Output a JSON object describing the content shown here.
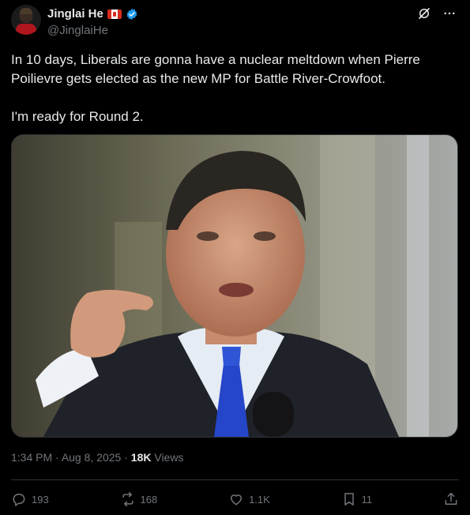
{
  "author": {
    "display_name": "Jinglai He",
    "handle": "@JinglaiHe",
    "flag_icon": "canada-flag-icon",
    "verified_icon": "verified-badge-icon"
  },
  "tweet": {
    "text_line1": "In 10 days, Liberals are gonna have a nuclear meltdown when Pierre Poilievre gets elected as the new MP for Battle River-Crowfoot.",
    "text_line2": "I'm ready for Round 2."
  },
  "meta": {
    "time": "1:34 PM",
    "separator1": " · ",
    "date": "Aug 8, 2025",
    "separator2": " · ",
    "views_count": "18K",
    "views_label": " Views"
  },
  "actions": {
    "replies": "193",
    "reposts": "168",
    "likes": "1.1K",
    "bookmarks": "11"
  },
  "colors": {
    "background": "#000000",
    "text": "#e7e9ea",
    "muted": "#71767b",
    "verified": "#1d9bf0"
  }
}
